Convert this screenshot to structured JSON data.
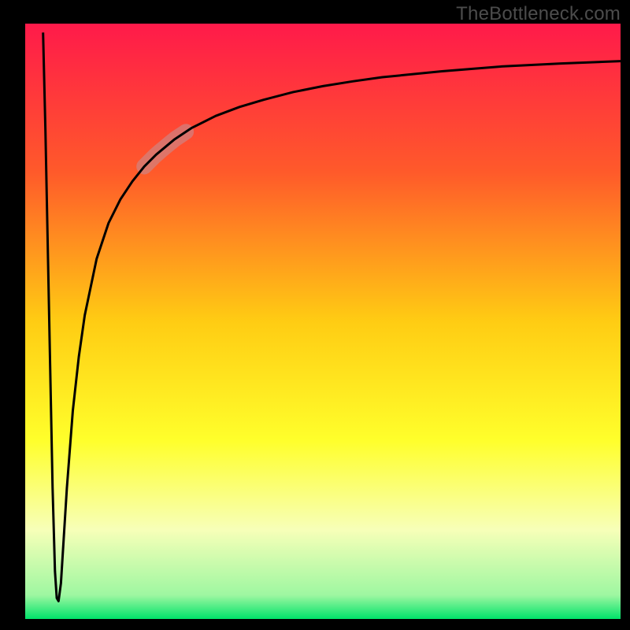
{
  "watermark": "TheBottleneck.com",
  "chart_data": {
    "type": "line",
    "title": "",
    "xlabel": "",
    "ylabel": "",
    "xlim": [
      0,
      100
    ],
    "ylim": [
      0,
      100
    ],
    "grid": false,
    "legend": false,
    "axes_visible": false,
    "background_gradient": {
      "type": "vertical",
      "stops": [
        {
          "offset": 0.0,
          "color": "#ff1a4a"
        },
        {
          "offset": 0.25,
          "color": "#ff5a2a"
        },
        {
          "offset": 0.5,
          "color": "#ffcc13"
        },
        {
          "offset": 0.7,
          "color": "#ffff2b"
        },
        {
          "offset": 0.85,
          "color": "#f7ffb8"
        },
        {
          "offset": 0.96,
          "color": "#9ef7a1"
        },
        {
          "offset": 1.0,
          "color": "#00e36a"
        }
      ]
    },
    "highlight_segment": {
      "x_start": 20,
      "x_end": 27,
      "color": "#c88a8e",
      "opacity": 0.62
    },
    "series": [
      {
        "name": "curve",
        "color": "#000000",
        "x": [
          3.0,
          3.4,
          3.8,
          4.2,
          4.6,
          5.0,
          5.3,
          5.6,
          6.0,
          6.5,
          7.0,
          8.0,
          9.0,
          10.0,
          12.0,
          14.0,
          16.0,
          18.0,
          20.0,
          22.0,
          25.0,
          28.0,
          32.0,
          36.0,
          40.0,
          45.0,
          50.0,
          55.0,
          60.0,
          70.0,
          80.0,
          90.0,
          100.0
        ],
        "values": [
          98.5,
          82.0,
          62.0,
          42.0,
          22.0,
          8.0,
          3.5,
          3.0,
          6.0,
          14.0,
          22.0,
          35.0,
          44.0,
          51.0,
          60.5,
          66.5,
          70.5,
          73.5,
          76.0,
          78.0,
          80.5,
          82.5,
          84.5,
          86.0,
          87.2,
          88.5,
          89.5,
          90.3,
          91.0,
          92.0,
          92.8,
          93.3,
          93.7
        ]
      }
    ]
  }
}
